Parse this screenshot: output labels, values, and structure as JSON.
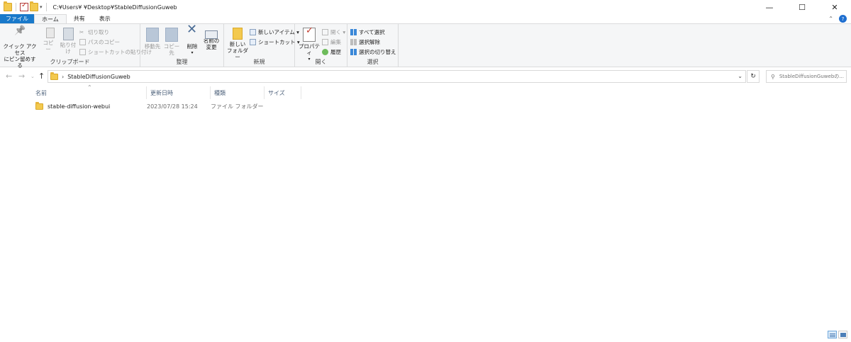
{
  "titlebar": {
    "path": "C:¥Users¥        ¥Desktop¥StableDiffusionGuweb",
    "minimize": "—",
    "maximize": "☐",
    "close": "✕"
  },
  "tabs": {
    "file": "ファイル",
    "home": "ホーム",
    "share": "共有",
    "view": "表示"
  },
  "ribbon": {
    "clipboard": {
      "label": "クリップボード",
      "pin_line1": "クイック アクセス",
      "pin_line2": "にピン留めする",
      "copy": "コピー",
      "paste": "貼り付け",
      "cut": "切り取り",
      "copy_path": "パスのコピー",
      "paste_shortcut": "ショートカットの貼り付け"
    },
    "organize": {
      "label": "整理",
      "move_to": "移動先",
      "copy_to": "コピー先",
      "delete": "削除",
      "rename_line1": "名前の",
      "rename_line2": "変更"
    },
    "new": {
      "label": "新規",
      "new_folder_line1": "新しい",
      "new_folder_line2": "フォルダー",
      "new_item": "新しいアイテム ▾",
      "easy_access": "ショートカット ▾"
    },
    "open": {
      "label": "開く",
      "properties": "プロパティ",
      "open": "開く ▾",
      "edit": "編集",
      "history": "履歴"
    },
    "select": {
      "label": "選択",
      "select_all": "すべて選択",
      "select_none": "選択解除",
      "invert": "選択の切り替え"
    }
  },
  "address": {
    "crumb": "StableDiffusionGuweb",
    "search_placeholder": "StableDiffusionGuwebの..."
  },
  "columns": {
    "name": "名前",
    "modified": "更新日時",
    "type": "種類",
    "size": "サイズ"
  },
  "files": [
    {
      "name": "stable-diffusion-webui",
      "modified": "2023/07/28 15:24",
      "type": "ファイル フォルダー",
      "size": ""
    }
  ]
}
